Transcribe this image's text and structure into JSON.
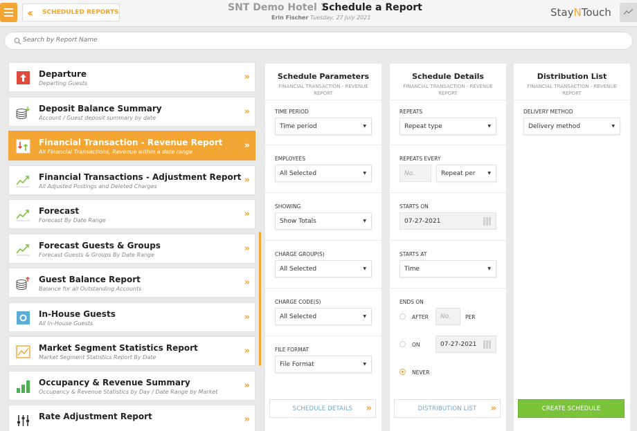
{
  "header": {
    "back_label": "SCHEDULED REPORTS",
    "hotel": "SNT Demo Hotel 1",
    "title": "Schedule a Report",
    "user": "Erin Fischer",
    "date": "Tuesday, 27 July 2021",
    "logo_a": "Stay",
    "logo_b": "N",
    "logo_c": "Touch",
    "accent_color": "#f3a633"
  },
  "search": {
    "placeholder": "Search by Report Name"
  },
  "reports": [
    {
      "name": "Departure",
      "sub": "Departing Guests",
      "icon": "departure-icon"
    },
    {
      "name": "Deposit Balance Summary",
      "sub": "Account / Guest deposit summary by date",
      "icon": "deposit-coins-icon"
    },
    {
      "name": "Financial Transaction - Revenue Report",
      "sub": "All Financial Transactions, Revenue within a date range",
      "icon": "transaction-icon",
      "selected": true
    },
    {
      "name": "Financial Transactions - Adjustment Report",
      "sub": "All Adjusted Postings and Deleted Charges",
      "icon": "trend-icon"
    },
    {
      "name": "Forecast",
      "sub": "Forecast By Date Range",
      "icon": "trend-icon"
    },
    {
      "name": "Forecast Guests & Groups",
      "sub": "Forecast Guests & Groups By Date Range",
      "icon": "trend-icon"
    },
    {
      "name": "Guest Balance Report",
      "sub": "Balance for all Outstanding Accounts",
      "icon": "balance-coins-icon"
    },
    {
      "name": "In-House Guests",
      "sub": "All In-House Guests",
      "icon": "in-house-icon"
    },
    {
      "name": "Market Segment Statistics Report",
      "sub": "Market Segment Statistics Report By Date",
      "icon": "market-chart-icon"
    },
    {
      "name": "Occupancy & Revenue Summary",
      "sub": "Occupancy & Revenue Statistics by Day / Date Range by Market",
      "icon": "bar-chart-icon"
    },
    {
      "name": "Rate Adjustment Report",
      "sub": "",
      "icon": "sliders-icon"
    }
  ],
  "params": {
    "title": "Schedule Parameters",
    "subtitle": "FINANCIAL TRANSACTION - REVENUE REPORT",
    "time_period_label": "TIME PERIOD",
    "time_period_value": "Time period",
    "employees_label": "EMPLOYEES",
    "employees_value": "All Selected",
    "showing_label": "SHOWING",
    "showing_value": "Show Totals",
    "charge_groups_label": "CHARGE GROUP(S)",
    "charge_groups_value": "All Selected",
    "charge_codes_label": "CHARGE CODE(S)",
    "charge_codes_value": "All Selected",
    "file_format_label": "FILE FORMAT",
    "file_format_value": "File Format",
    "next_label": "SCHEDULE DETAILS"
  },
  "details": {
    "title": "Schedule Details",
    "subtitle": "FINANCIAL TRANSACTION - REVENUE REPORT",
    "repeats_label": "REPEATS",
    "repeats_value": "Repeat type",
    "repeats_every_label": "REPEATS EVERY",
    "repeats_every_placeholder": "No.",
    "repeat_per_value": "Repeat per",
    "starts_on_label": "STARTS ON",
    "starts_on_value": "07-27-2021",
    "starts_at_label": "STARTS AT",
    "starts_at_value": "Time",
    "ends_on_label": "ENDS ON",
    "after_label": "AFTER",
    "after_placeholder": "No.",
    "per_label": "PER",
    "on_label": "ON",
    "on_date": "07-27-2021",
    "never_label": "NEVER",
    "ends_selected": "NEVER",
    "next_label": "DISTRIBUTION LIST"
  },
  "distribution": {
    "title": "Distribution List",
    "subtitle": "FINANCIAL TRANSACTION - REVENUE REPORT",
    "delivery_label": "DELIVERY METHOD",
    "delivery_value": "Delivery method",
    "create_label": "CREATE SCHEDULE",
    "create_color": "#7cc33c"
  }
}
